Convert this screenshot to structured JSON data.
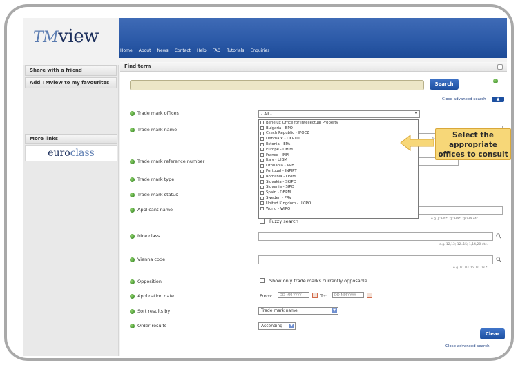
{
  "header": {
    "logo_prefix": "TM",
    "logo_word": "view",
    "nav": [
      "Home",
      "About",
      "News",
      "Contact",
      "Help",
      "FAQ",
      "Tutorials",
      "Enquiries"
    ]
  },
  "sidebar": {
    "share": "Share with a friend",
    "favourites": "Add TMview to my favourites",
    "more_links": "More links",
    "euroclass_prefix": "euro",
    "euroclass_suffix": "class"
  },
  "main": {
    "find_term": "Find term",
    "search_button": "Search",
    "close_advanced_top": "Close advanced search",
    "close_advanced_bottom": "Close advanced search",
    "clear_button": "Clear",
    "fields": {
      "offices": "Trade mark offices",
      "name": "Trade mark name",
      "reference": "Trade mark reference number",
      "type": "Trade mark type",
      "status": "Trade mark status",
      "applicant": "Applicant name",
      "nice": "Nice class",
      "vienna": "Vienna code",
      "opposition": "Opposition",
      "app_date": "Application date",
      "sort": "Sort results by",
      "order": "Order results"
    },
    "offices_select": "- All -",
    "offices_options": [
      "Benelux Office for Intellectual Property",
      "Bulgaria - BPO",
      "Czech Republic - IPOCZ",
      "Denmark - DKPTO",
      "Estonia - EPA",
      "Europe - OHIM",
      "France - INPI",
      "Italy - UIBM",
      "Lithuania - VPB",
      "Portugal - INPIPT",
      "Romania - OSIM",
      "Slovakia - SKIPO",
      "Slovenia - SIPO",
      "Spain - OEPM",
      "Sweden - PRV",
      "United Kingdom - UKIPO",
      "World - WIPO"
    ],
    "hint_name": "e.g. COLA*,",
    "hint_applicant": "e.g. JOHN*, *JOHN*, *JOHN etc.",
    "hint_nice": "e.g. 12,13; 12..15; 1,14,20 etc.",
    "hint_vienna": "e.g. 01.03.06, 01.03.*",
    "fuzzy": "Fuzzy search",
    "opposition_text": "Show only trade marks currently opposable",
    "from_label": "From:",
    "to_label": "To:",
    "date_placeholder": "DD-MM-YYYY",
    "sort_value": "Trade mark name",
    "order_value": "Ascending"
  },
  "callout": {
    "text": "Select the appropriate offices to consult"
  }
}
